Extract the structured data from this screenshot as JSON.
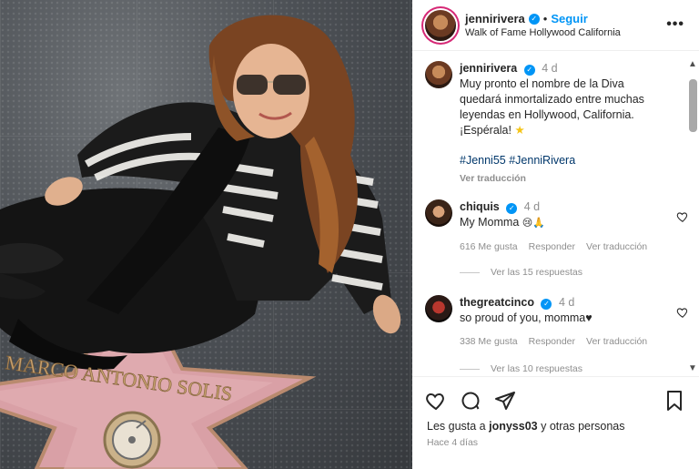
{
  "post": {
    "username": "jennirivera",
    "follow_label": "Seguir",
    "dot": "•",
    "location": "Walk of Fame Hollywood California",
    "more_label": "•••",
    "star_name": "MARCO ANTONIO SOLIS"
  },
  "caption": {
    "username": "jennirivera",
    "time": "4 d",
    "line1": "Muy pronto el nombre de la Diva",
    "line2": "quedará inmortalizado entre muchas",
    "line3": "leyendas en Hollywood, California.",
    "line4": "¡Espérala!",
    "emoji": "★",
    "hashtags": "#Jenni55 #JenniRivera",
    "translate": "Ver traducción"
  },
  "comments": [
    {
      "username": "chiquis",
      "time": "4 d",
      "text": "My Momma",
      "emoji": "😢🙏",
      "likes": "616 Me gusta",
      "reply": "Responder",
      "translate": "Ver traducción",
      "replies": "Ver las 15 respuestas"
    },
    {
      "username": "thegreatcinco",
      "time": "4 d",
      "text": "so proud of you, momma",
      "emoji": "♥",
      "likes": "338 Me gusta",
      "reply": "Responder",
      "translate": "Ver traducción",
      "replies": "Ver las 10 respuestas"
    }
  ],
  "footer": {
    "likes_prefix": "Les gusta a ",
    "likes_user": "jonyss03",
    "likes_suffix": " y otras personas",
    "ago": "Hace 4 días"
  },
  "scrollbar": {
    "up": "▲",
    "down": "▼"
  },
  "colors": {
    "accent": "#0095f6",
    "text": "#262626",
    "muted": "#8e8e8e",
    "hashtag": "#00376b"
  }
}
